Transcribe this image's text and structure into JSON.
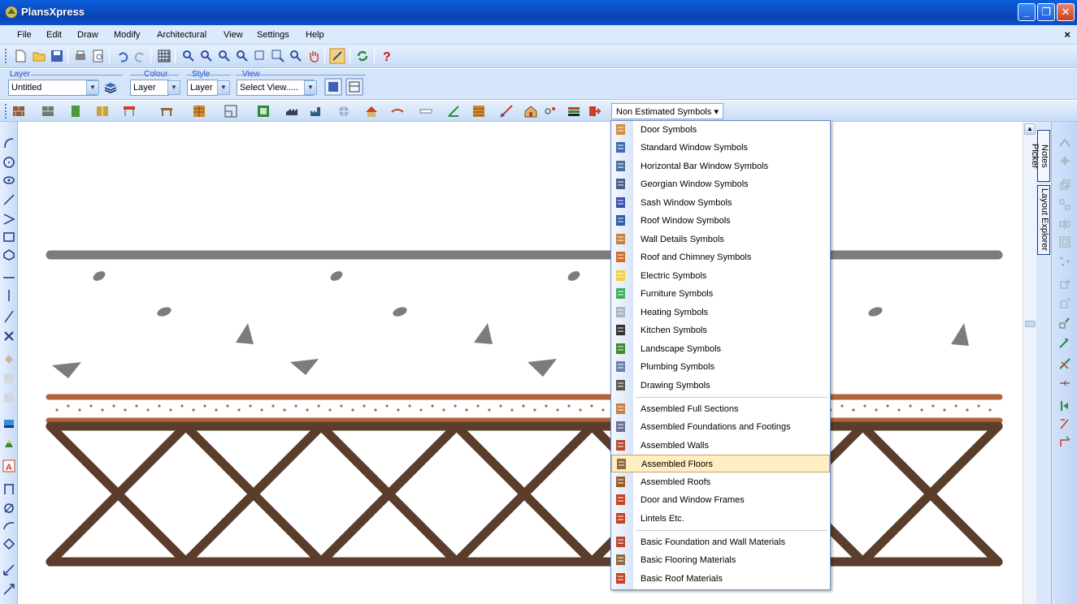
{
  "window": {
    "title": "PlansXpress"
  },
  "menubar": {
    "items": [
      "File",
      "Edit",
      "Draw",
      "Modify",
      "Architectural",
      "View",
      "Settings",
      "Help"
    ],
    "close": "×"
  },
  "groups": {
    "layer": {
      "label": "Layer",
      "value": "Untitled"
    },
    "colour": {
      "label": "Colour",
      "value": "Layer"
    },
    "style": {
      "label": "Style",
      "value": "Layer"
    },
    "view": {
      "label": "View",
      "value": "Select View....."
    }
  },
  "symbols_combo": {
    "label": "Non Estimated Symbols"
  },
  "right_tabs": {
    "notes": "Notes Picker",
    "layout": "Layout Explorer"
  },
  "menu": {
    "items": [
      {
        "label": "Door Symbols",
        "icon": "door-icon",
        "color": "#d9893a"
      },
      {
        "label": "Standard Window Symbols",
        "icon": "window-icon",
        "color": "#3b6cb5"
      },
      {
        "label": "Horizontal Bar Window Symbols",
        "icon": "window-hbar-icon",
        "color": "#4c6f9e"
      },
      {
        "label": "Georgian Window Symbols",
        "icon": "georgian-window-icon",
        "color": "#4a5f88"
      },
      {
        "label": "Sash Window Symbols",
        "icon": "sash-window-icon",
        "color": "#3a4fb5"
      },
      {
        "label": "Roof Window Symbols",
        "icon": "roof-window-icon",
        "color": "#2f5aa6"
      },
      {
        "label": "Wall Details Symbols",
        "icon": "wall-details-icon",
        "color": "#c9803c"
      },
      {
        "label": "Roof and Chimney Symbols",
        "icon": "roof-chimney-icon",
        "color": "#d66a2a"
      },
      {
        "label": "Electric Symbols",
        "icon": "bulb-icon",
        "color": "#f2d23c"
      },
      {
        "label": "Furniture Symbols",
        "icon": "furniture-icon",
        "color": "#3fae5e"
      },
      {
        "label": "Heating Symbols",
        "icon": "radiator-icon",
        "color": "#a9b4c8"
      },
      {
        "label": "Kitchen Symbols",
        "icon": "hob-icon",
        "color": "#333333"
      },
      {
        "label": "Landscape Symbols",
        "icon": "landscape-icon",
        "color": "#3d8a2c"
      },
      {
        "label": "Plumbing Symbols",
        "icon": "tap-icon",
        "color": "#6a7fb0"
      },
      {
        "label": "Drawing Symbols",
        "icon": "pencil-icon",
        "color": "#555555"
      },
      {
        "label": "Assembled Full Sections",
        "icon": "full-section-icon",
        "color": "#c9803c"
      },
      {
        "label": "Assembled Foundations and Footings",
        "icon": "foundation-icon",
        "color": "#6a6f99"
      },
      {
        "label": "Assembled Walls",
        "icon": "walls-icon",
        "color": "#b9492a"
      },
      {
        "label": "Assembled Floors",
        "icon": "floors-icon",
        "color": "#8c6a3c"
      },
      {
        "label": "Assembled Roofs",
        "icon": "roofs-icon",
        "color": "#9a5a2a"
      },
      {
        "label": "Door and Window Frames",
        "icon": "frames-icon",
        "color": "#c9401e"
      },
      {
        "label": "Lintels Etc.",
        "icon": "lintel-icon",
        "color": "#c9401e"
      },
      {
        "label": "Basic Foundation and Wall Materials",
        "icon": "wall-materials-icon",
        "color": "#b9492a"
      },
      {
        "label": "Basic Flooring Materials",
        "icon": "flooring-materials-icon",
        "color": "#8c6a3c"
      },
      {
        "label": "Basic Roof Materials",
        "icon": "roof-materials-icon",
        "color": "#c9401e"
      }
    ],
    "highlighted": "Assembled Floors"
  },
  "colors": {
    "titlebar": "#0c4fc4",
    "slab": "#7f7a80",
    "joist": "#5a3e2b",
    "screed": "#b2653c"
  }
}
